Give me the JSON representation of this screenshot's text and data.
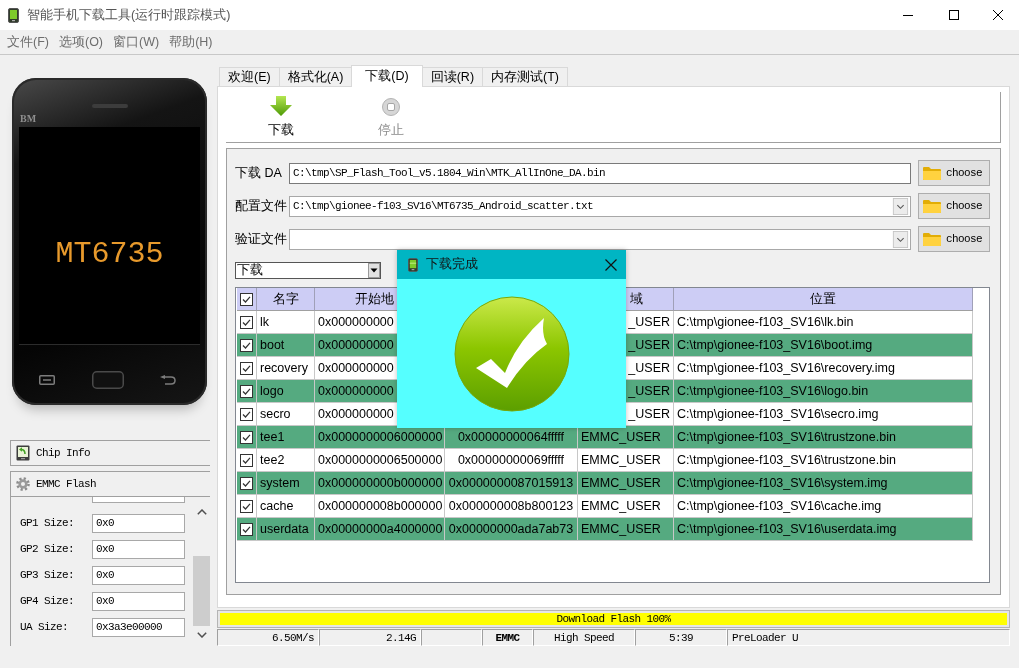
{
  "window": {
    "title": "智能手机下载工具(运行时跟踪模式)"
  },
  "menu": [
    "文件(F)",
    "选项(O)",
    "窗口(W)",
    "帮助(H)"
  ],
  "device": {
    "brand": "BM",
    "chip": "MT6735"
  },
  "device_panel": {
    "sections": [
      {
        "kind": "info",
        "label": "Chip Info"
      },
      {
        "kind": "flash",
        "label": "EMMC Flash"
      }
    ],
    "fields": [
      {
        "label": "GP1 Size:",
        "value": "0x0"
      },
      {
        "label": "GP2 Size:",
        "value": "0x0"
      },
      {
        "label": "GP3 Size:",
        "value": "0x0"
      },
      {
        "label": "GP4 Size:",
        "value": "0x0"
      },
      {
        "label": "UA Size:",
        "value": "0x3a3e00000"
      }
    ]
  },
  "tabs": [
    {
      "label": "欢迎(E)",
      "selected": false
    },
    {
      "label": "格式化(A)",
      "selected": false
    },
    {
      "label": "下载(D)",
      "selected": true
    },
    {
      "label": "回读(R)",
      "selected": false
    },
    {
      "label": "内存测试(T)",
      "selected": false
    }
  ],
  "toolbar": [
    {
      "kind": "download",
      "label": "下载",
      "disabled": false
    },
    {
      "kind": "stop",
      "label": "停止",
      "disabled": true
    }
  ],
  "files": [
    {
      "kind": "text",
      "label": "下载 DA",
      "value": "C:\\tmp\\SP_Flash_Tool_v5.1804_Win\\MTK_AllInOne_DA.bin",
      "button": "choose"
    },
    {
      "kind": "combo",
      "label": "配置文件",
      "value": "C:\\tmp\\gionee-f103_SV16\\MT6735_Android_scatter.txt",
      "button": "choose"
    },
    {
      "kind": "combo",
      "label": "验证文件",
      "button": "choose"
    }
  ],
  "mode": {
    "value": "下载"
  },
  "table": {
    "all_checked": true,
    "columns": {
      "name": "名字",
      "column_2": "开始地",
      "column_4": "域",
      "location": "位置"
    },
    "rows": [
      {
        "checked": true,
        "name": "lk",
        "column_2": "0x000000000",
        "column_4": "_USER",
        "location": "C:\\tmp\\gionee-f103_SV16\\lk.bin"
      },
      {
        "checked": true,
        "name": "boot",
        "column_2": "0x000000000",
        "column_4": "_USER",
        "location": "C:\\tmp\\gionee-f103_SV16\\boot.img"
      },
      {
        "checked": true,
        "name": "recovery",
        "column_2": "0x000000000",
        "column_4": "_USER",
        "location": "C:\\tmp\\gionee-f103_SV16\\recovery.img"
      },
      {
        "checked": true,
        "name": "logo",
        "column_2": "0x000000000",
        "column_4": "_USER",
        "location": "C:\\tmp\\gionee-f103_SV16\\logo.bin"
      },
      {
        "checked": true,
        "name": "secro",
        "column_2": "0x000000000",
        "column_4": "_USER",
        "location": "C:\\tmp\\gionee-f103_SV16\\secro.img"
      },
      {
        "checked": true,
        "name": "tee1",
        "column_2": "0x0000000006000000",
        "column_3": "0x00000000064fffff",
        "column_4": "EMMC_USER",
        "location": "C:\\tmp\\gionee-f103_SV16\\trustzone.bin"
      },
      {
        "checked": true,
        "name": "tee2",
        "column_2": "0x0000000006500000",
        "column_3": "0x00000000069fffff",
        "column_4": "EMMC_USER",
        "location": "C:\\tmp\\gionee-f103_SV16\\trustzone.bin"
      },
      {
        "checked": true,
        "name": "system",
        "column_2": "0x000000000b000000",
        "column_3": "0x0000000087015913",
        "column_4": "EMMC_USER",
        "location": "C:\\tmp\\gionee-f103_SV16\\system.img"
      },
      {
        "checked": true,
        "name": "cache",
        "column_2": "0x000000008b000000",
        "column_3": "0x000000008b800123",
        "column_4": "EMMC_USER",
        "location": "C:\\tmp\\gionee-f103_SV16\\cache.img"
      },
      {
        "checked": true,
        "name": "userdata",
        "column_2": "0x00000000a4000000",
        "column_3": "0x00000000ada7ab73",
        "column_4": "EMMC_USER",
        "location": "C:\\tmp\\gionee-f103_SV16\\userdata.img"
      }
    ]
  },
  "dialog": {
    "title": "下载完成"
  },
  "progress": {
    "label": "Download Flash 100%",
    "level": 1
  },
  "status_bar": [
    {
      "kind": "value",
      "text": "6.50M/s"
    },
    {
      "kind": "value",
      "text": "2.14G"
    },
    {
      "kind": "blank"
    },
    {
      "kind": "storage",
      "text": "EMMC"
    },
    {
      "kind": "info",
      "text": "High Speed"
    },
    {
      "kind": "info",
      "text": "5:39"
    },
    {
      "kind": "port",
      "text": "PreLoader U"
    }
  ]
}
